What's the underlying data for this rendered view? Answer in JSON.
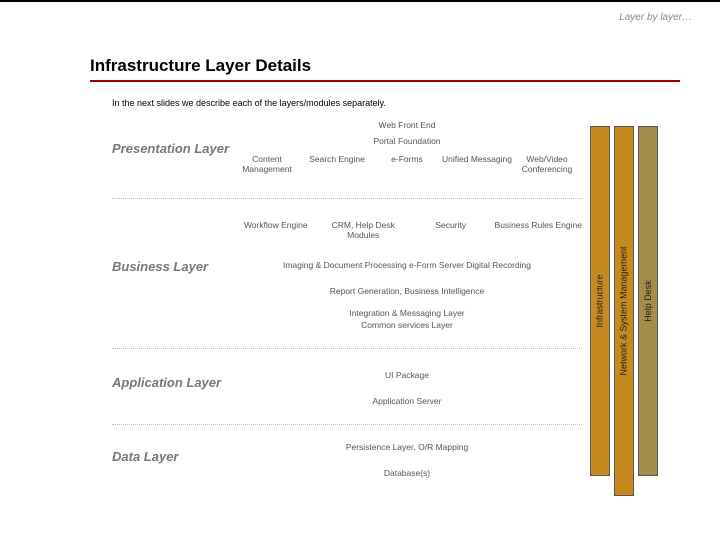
{
  "breadcrumb": "Layer by layer…",
  "title": "Infrastructure Layer Details",
  "intro": "In the next slides we describe each of the layers/modules separately.",
  "layers": {
    "presentation": "Presentation Layer",
    "business": "Business Layer",
    "application": "Application Layer",
    "data": "Data Layer"
  },
  "rows": {
    "webfront": "Web Front End",
    "portal": "Portal Foundation",
    "pres_cells": {
      "c1": "Content Management",
      "c2": "Search Engine",
      "c3": "e-Forms",
      "c4": "Unified Messaging",
      "c5": "Web/Video Conferencing"
    },
    "biz1": {
      "c1": "Workflow Engine",
      "c2": "CRM, Help Desk Modules",
      "c3": "Security",
      "c4": "Business Rules Engine"
    },
    "biz2": "Imaging & Document Processing   e-Form Server   Digital Recording",
    "biz3": "Report Generation, Business Intelligence",
    "biz4a": "Integration & Messaging Layer",
    "biz4b": "Common services Layer",
    "app1": "UI Package",
    "app2": "Application Server",
    "data1": "Persistence Layer, O/R Mapping",
    "data2": "Database(s)"
  },
  "pillars": {
    "infra": "Infrastructure",
    "net": "Network & System Management",
    "help": "Help Desk"
  }
}
